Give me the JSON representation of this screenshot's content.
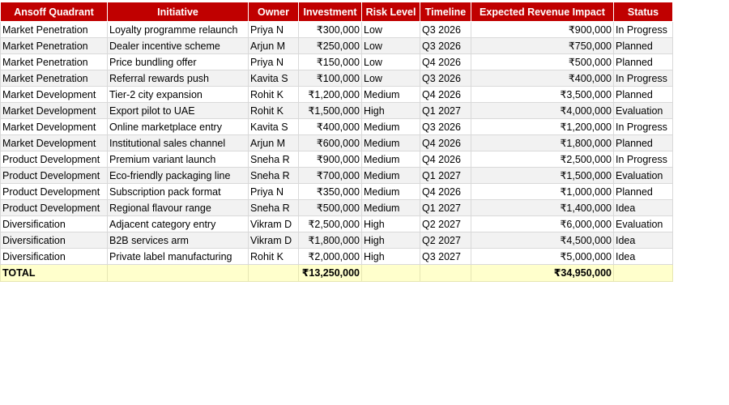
{
  "headers": [
    "Ansoff Quadrant",
    "Initiative",
    "Owner",
    "Investment",
    "Risk Level",
    "Timeline",
    "Expected Revenue Impact",
    "Status"
  ],
  "rows": [
    [
      "Market Penetration",
      "Loyalty programme relaunch",
      "Priya N",
      "₹300,000",
      "Low",
      "Q3 2026",
      "₹900,000",
      "In Progress"
    ],
    [
      "Market Penetration",
      "Dealer incentive scheme",
      "Arjun M",
      "₹250,000",
      "Low",
      "Q3 2026",
      "₹750,000",
      "Planned"
    ],
    [
      "Market Penetration",
      "Price bundling offer",
      "Priya N",
      "₹150,000",
      "Low",
      "Q4 2026",
      "₹500,000",
      "Planned"
    ],
    [
      "Market Penetration",
      "Referral rewards push",
      "Kavita S",
      "₹100,000",
      "Low",
      "Q3 2026",
      "₹400,000",
      "In Progress"
    ],
    [
      "Market Development",
      "Tier-2 city expansion",
      "Rohit K",
      "₹1,200,000",
      "Medium",
      "Q4 2026",
      "₹3,500,000",
      "Planned"
    ],
    [
      "Market Development",
      "Export pilot to UAE",
      "Rohit K",
      "₹1,500,000",
      "High",
      "Q1 2027",
      "₹4,000,000",
      "Evaluation"
    ],
    [
      "Market Development",
      "Online marketplace entry",
      "Kavita S",
      "₹400,000",
      "Medium",
      "Q3 2026",
      "₹1,200,000",
      "In Progress"
    ],
    [
      "Market Development",
      "Institutional sales channel",
      "Arjun M",
      "₹600,000",
      "Medium",
      "Q4 2026",
      "₹1,800,000",
      "Planned"
    ],
    [
      "Product Development",
      "Premium variant launch",
      "Sneha R",
      "₹900,000",
      "Medium",
      "Q4 2026",
      "₹2,500,000",
      "In Progress"
    ],
    [
      "Product Development",
      "Eco-friendly packaging line",
      "Sneha R",
      "₹700,000",
      "Medium",
      "Q1 2027",
      "₹1,500,000",
      "Evaluation"
    ],
    [
      "Product Development",
      "Subscription pack format",
      "Priya N",
      "₹350,000",
      "Medium",
      "Q4 2026",
      "₹1,000,000",
      "Planned"
    ],
    [
      "Product Development",
      "Regional flavour range",
      "Sneha R",
      "₹500,000",
      "Medium",
      "Q1 2027",
      "₹1,400,000",
      "Idea"
    ],
    [
      "Diversification",
      "Adjacent category entry",
      "Vikram D",
      "₹2,500,000",
      "High",
      "Q2 2027",
      "₹6,000,000",
      "Evaluation"
    ],
    [
      "Diversification",
      "B2B services arm",
      "Vikram D",
      "₹1,800,000",
      "High",
      "Q2 2027",
      "₹4,500,000",
      "Idea"
    ],
    [
      "Diversification",
      "Private label manufacturing",
      "Rohit K",
      "₹2,000,000",
      "High",
      "Q3 2027",
      "₹5,000,000",
      "Idea"
    ]
  ],
  "total": [
    "TOTAL",
    "",
    "",
    "₹13,250,000",
    "",
    "",
    "₹34,950,000",
    ""
  ],
  "colors": {
    "header_bg": "#c00000",
    "header_text": "#ffffff",
    "alt_row_bg": "#f2f2f2",
    "total_row_bg": "#ffffcc"
  }
}
